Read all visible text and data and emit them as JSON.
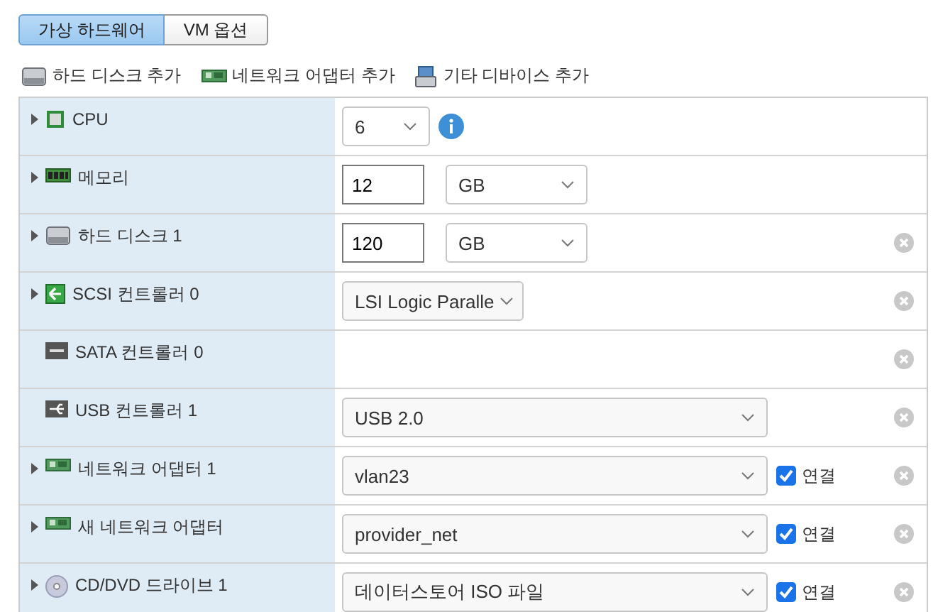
{
  "tabs": [
    {
      "label": "가상 하드웨어",
      "selected": true
    },
    {
      "label": "VM 옵션",
      "selected": false
    }
  ],
  "toolbar": [
    {
      "label": "하드 디스크 추가",
      "kind": "disk"
    },
    {
      "label": "네트워크 어댑터 추가",
      "kind": "nic"
    },
    {
      "label": "기타 디바이스 추가",
      "kind": "device"
    }
  ],
  "rows": [
    {
      "label": "CPU",
      "kind": "cpu",
      "expandable": true,
      "removable": false,
      "controls": [
        {
          "kind": "count-select",
          "value": "6"
        },
        {
          "kind": "info"
        }
      ]
    },
    {
      "label": "메모리",
      "kind": "memory",
      "expandable": true,
      "removable": false,
      "controls": [
        {
          "kind": "number-input",
          "value": "12"
        },
        {
          "kind": "unit-select",
          "value": "GB"
        }
      ]
    },
    {
      "label": "하드 디스크 1",
      "kind": "disk",
      "expandable": true,
      "removable": true,
      "controls": [
        {
          "kind": "number-input",
          "value": "120"
        },
        {
          "kind": "unit-select",
          "value": "GB"
        }
      ]
    },
    {
      "label": "SCSI 컨트롤러 0",
      "kind": "scsi",
      "expandable": true,
      "removable": true,
      "controls": [
        {
          "kind": "compact-select",
          "value": "LSI Logic Paralle"
        }
      ]
    },
    {
      "label": "SATA 컨트롤러 0",
      "kind": "sata",
      "expandable": false,
      "removable": true,
      "controls": []
    },
    {
      "label": "USB 컨트롤러 1",
      "kind": "usb",
      "expandable": false,
      "removable": true,
      "controls": [
        {
          "kind": "wide-select",
          "value": "USB 2.0"
        }
      ]
    },
    {
      "label": "네트워크 어댑터 1",
      "kind": "nic",
      "expandable": true,
      "removable": true,
      "controls": [
        {
          "kind": "wide-select",
          "value": "vlan23"
        },
        {
          "kind": "checkbox",
          "label": "연결",
          "checked": true
        }
      ]
    },
    {
      "label": "새 네트워크 어댑터",
      "kind": "nic",
      "expandable": true,
      "removable": true,
      "controls": [
        {
          "kind": "wide-select",
          "value": "provider_net"
        },
        {
          "kind": "checkbox",
          "label": "연결",
          "checked": true
        }
      ]
    },
    {
      "label": "CD/DVD 드라이브 1",
      "kind": "cdrom",
      "expandable": true,
      "removable": true,
      "controls": [
        {
          "kind": "wide-select",
          "value": "데이터스토어 ISO 파일"
        },
        {
          "kind": "checkbox",
          "label": "연결",
          "checked": true
        }
      ]
    }
  ]
}
